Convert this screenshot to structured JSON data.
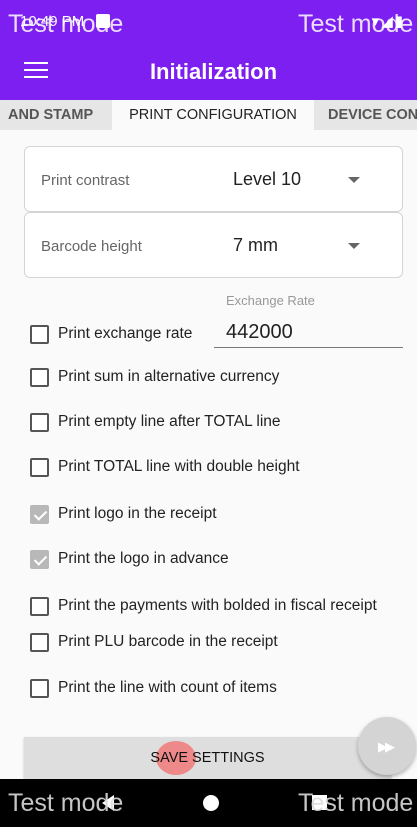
{
  "status_bar": {
    "time": "10:49 PM",
    "watermark_left": "Test mode",
    "watermark_right": "Test mode",
    "signal_icons": "▾◢▮"
  },
  "app_bar": {
    "title": "Initialization",
    "menu_icon": "hamburger-menu-icon"
  },
  "tabs": [
    {
      "label": "AND STAMP",
      "active": false
    },
    {
      "label": "PRINT CONFIGURATION",
      "active": true
    },
    {
      "label": "DEVICE CON",
      "active": false
    }
  ],
  "print_contrast": {
    "label": "Print contrast",
    "value": "Level 10"
  },
  "barcode_height": {
    "label": "Barcode height",
    "value": "7 mm"
  },
  "exchange_rate": {
    "hint": "Exchange Rate",
    "value": "442000"
  },
  "options": [
    {
      "label": "Print exchange rate",
      "checked": false
    },
    {
      "label": "Print sum in alternative currency",
      "checked": false
    },
    {
      "label": "Print empty line after TOTAL line",
      "checked": false
    },
    {
      "label": "Print TOTAL line with double height",
      "checked": false
    },
    {
      "label": "Print logo in the receipt",
      "checked": true
    },
    {
      "label": "Print the logo in advance",
      "checked": true
    },
    {
      "label": "Print the payments with bolded in fiscal receipt",
      "checked": false
    },
    {
      "label": "Print PLU barcode in the receipt",
      "checked": false
    },
    {
      "label": "Print the line with count of items",
      "checked": false
    }
  ],
  "save_button": {
    "label": "SAVE SETTINGS"
  },
  "fab": {
    "icon": "fast-forward-icon",
    "glyph": "▶▶"
  },
  "nav_bar": {
    "watermark_left": "Test mode",
    "watermark_right": "Test mode"
  },
  "colors": {
    "primary": "#7c1ff0",
    "checkbox_checked": "#b8b8b8",
    "ripple": "#ee7f7f"
  }
}
